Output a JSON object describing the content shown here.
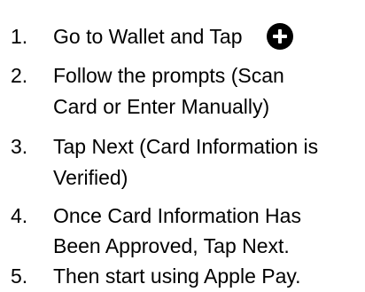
{
  "steps": [
    {
      "number": "1.",
      "lines": [
        "Go to Wallet and Tap"
      ],
      "icon": "plus-circle-icon"
    },
    {
      "number": "2.",
      "lines": [
        "Follow the prompts (Scan",
        "Card or Enter Manually)"
      ]
    },
    {
      "number": "3.",
      "lines": [
        "Tap Next (Card Information is",
        "Verified)"
      ]
    },
    {
      "number": "4.",
      "lines": [
        "Once Card Information Has",
        "Been Approved, Tap Next."
      ]
    },
    {
      "number": "5.",
      "lines": [
        "Then start using Apple Pay."
      ]
    }
  ]
}
